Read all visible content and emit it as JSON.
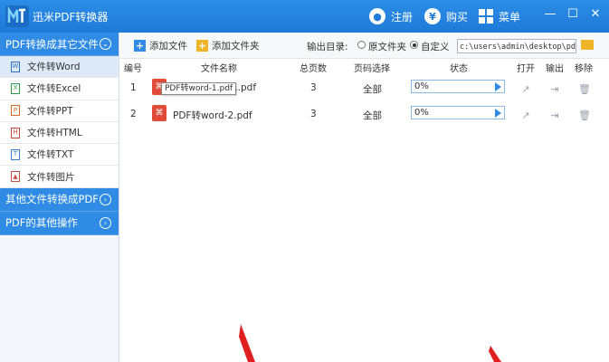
{
  "app": {
    "title": "迅米PDF转换器"
  },
  "titlebar": {
    "register": "注册",
    "buy": "购买",
    "menu": "菜单",
    "buy_icon": "¥"
  },
  "sidebar": {
    "group1": "PDF转换成其它文件",
    "items": [
      {
        "label": "文件转Word",
        "icon": "word-icon"
      },
      {
        "label": "文件转Excel",
        "icon": "excel-icon"
      },
      {
        "label": "文件转PPT",
        "icon": "ppt-icon"
      },
      {
        "label": "文件转HTML",
        "icon": "html-icon"
      },
      {
        "label": "文件转TXT",
        "icon": "txt-icon"
      },
      {
        "label": "文件转图片",
        "icon": "image-icon"
      }
    ],
    "group2": "其他文件转换成PDF",
    "group3": "PDF的其他操作"
  },
  "toolbar": {
    "add_file": "添加文件",
    "add_folder": "添加文件夹",
    "output_label": "输出目录:",
    "radio_original": "原文件夹",
    "radio_custom": "自定义",
    "selected_radio": "自定义",
    "output_path": "c:\\users\\admin\\desktop\\pdf合并"
  },
  "table": {
    "headers": [
      "编号",
      "文件名称",
      "总页数",
      "页码选择",
      "状态",
      "打开",
      "输出",
      "移除"
    ],
    "rows": [
      {
        "num": "1",
        "name": "PDF转word-1.pdf",
        "name_visible": "...pdf",
        "pages": "3",
        "range": "全部",
        "status": "0%"
      },
      {
        "num": "2",
        "name": "PDF转word-2.pdf",
        "pages": "3",
        "range": "全部",
        "status": "0%"
      }
    ]
  },
  "tooltip": {
    "text": "PDF转word-1.pdf"
  },
  "colors": {
    "accent": "#2f8be3",
    "titlebar": "#1f7ad8",
    "pdf_red": "#e04b3a",
    "annotation_red": "#e02020"
  }
}
